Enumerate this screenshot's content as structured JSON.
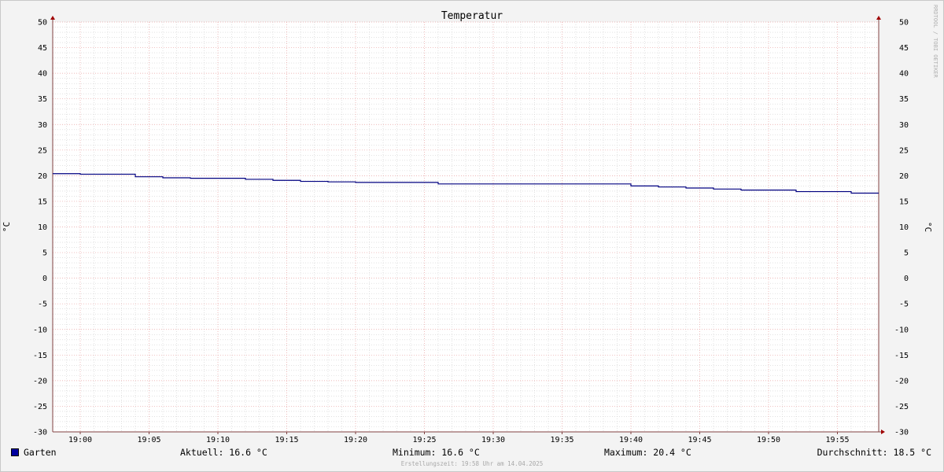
{
  "chart_data": {
    "type": "line",
    "title": "Temperatur",
    "ylabel": "°C",
    "ylim": [
      -30,
      50
    ],
    "yticks": [
      50,
      45,
      40,
      35,
      30,
      25,
      20,
      15,
      10,
      5,
      0,
      -5,
      -10,
      -15,
      -20,
      -25,
      -30
    ],
    "xlim": [
      "18:58",
      "19:58"
    ],
    "xticks": [
      "19:00",
      "19:05",
      "19:10",
      "19:15",
      "19:20",
      "19:25",
      "19:30",
      "19:35",
      "19:40",
      "19:45",
      "19:50",
      "19:55"
    ],
    "step": true,
    "grid": true,
    "series": [
      {
        "name": "Garten",
        "color": "#000080",
        "x": [
          "18:58",
          "19:00",
          "19:04",
          "19:06",
          "19:08",
          "19:12",
          "19:14",
          "19:16",
          "19:18",
          "19:20",
          "19:26",
          "19:40",
          "19:42",
          "19:44",
          "19:46",
          "19:48",
          "19:52",
          "19:56",
          "19:58"
        ],
        "y": [
          20.4,
          20.3,
          19.8,
          19.6,
          19.5,
          19.3,
          19.1,
          18.9,
          18.8,
          18.7,
          18.4,
          18.0,
          17.8,
          17.6,
          17.4,
          17.2,
          16.9,
          16.6,
          16.6
        ]
      }
    ]
  },
  "legend": {
    "series_label": "Garten",
    "current": "Aktuell: 16.6 °C",
    "minimum": "Minimum: 16.6 °C",
    "maximum": "Maximum: 20.4 °C",
    "average": "Durchschnitt: 18.5 °C"
  },
  "watermark": "RRDTOOL / TOBI OETIKER",
  "footer": "Erstellungszeit: 19:58 Uhr am 14.04.2025",
  "colors": {
    "background": "#f3f3f3",
    "canvas": "#ffffff",
    "series": "#000080",
    "major_grid": "#e8a0a0",
    "minor_grid": "#d0d0d0",
    "axis": "#804040"
  }
}
